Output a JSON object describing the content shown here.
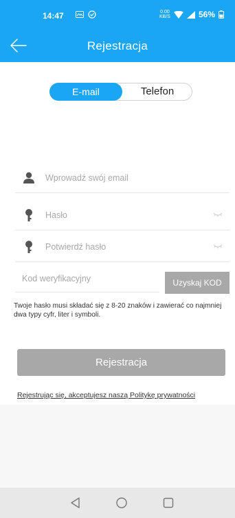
{
  "status_bar": {
    "time": "14:47",
    "net_speed_value": "0.00",
    "net_speed_unit": "KB/S",
    "battery": "56%"
  },
  "header": {
    "title": "Rejestracja"
  },
  "tabs": {
    "email_label": "E-mail",
    "phone_label": "Telefon",
    "active": "E-mail"
  },
  "form": {
    "email_placeholder": "Wprowadź swój email",
    "password_placeholder": "Hasło",
    "confirm_password_placeholder": "Potwierdź hasło",
    "code_placeholder": "Kod weryfikacyjny",
    "get_code_label": "Uzyskaj KOD"
  },
  "hint": "Twoje hasło musi składać się z 8-20 znaków i zawierać co najmniej dwa typy cyfr, liter i symboli.",
  "register_label": "Rejestracja",
  "terms": "Rejestrując się, akceptujesz naszą Politykę prywatności",
  "colors": {
    "accent": "#1aa6f5",
    "button_disabled": "#a8a8a8"
  }
}
